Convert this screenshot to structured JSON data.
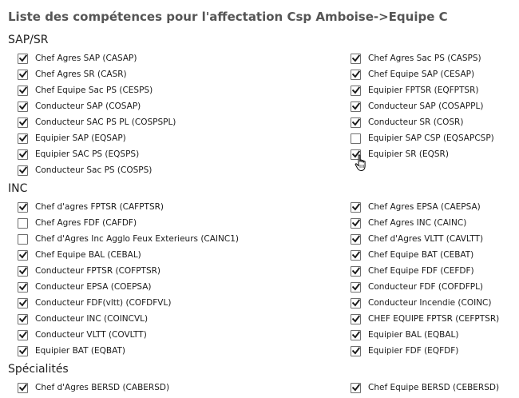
{
  "page": {
    "title": "Liste des compétences pour l'affectation Csp Amboise->Equipe C"
  },
  "sections": [
    {
      "title": "SAP/SR",
      "left": [
        {
          "label": "Chef Agres SAP (CASAP)",
          "checked": true
        },
        {
          "label": "Chef Agres SR (CASR)",
          "checked": true
        },
        {
          "label": "Chef Equipe Sac PS (CESPS)",
          "checked": true
        },
        {
          "label": "Conducteur SAP (COSAP)",
          "checked": true
        },
        {
          "label": "Conducteur SAC PS PL (COSPSPL)",
          "checked": true
        },
        {
          "label": "Equipier SAP (EQSAP)",
          "checked": true
        },
        {
          "label": "Equipier SAC PS (EQSPS)",
          "checked": true
        },
        {
          "label": "Conducteur Sac PS (COSPS)",
          "checked": true
        }
      ],
      "right": [
        {
          "label": "Chef Agres Sac PS (CASPS)",
          "checked": true
        },
        {
          "label": "Chef Equipe SAP (CESAP)",
          "checked": true
        },
        {
          "label": "Equipier FPTSR (EQFPTSR)",
          "checked": true
        },
        {
          "label": "Conducteur SAP (COSAPPL)",
          "checked": true
        },
        {
          "label": "Conducteur SR (COSR)",
          "checked": true
        },
        {
          "label": "Equipier SAP CSP (EQSAPCSP)",
          "checked": false
        },
        {
          "label": "Equipier SR (EQSR)",
          "checked": true
        }
      ]
    },
    {
      "title": "INC",
      "left": [
        {
          "label": "Chef d'agres FPTSR (CAFPTSR)",
          "checked": true
        },
        {
          "label": "Chef Agres FDF (CAFDF)",
          "checked": false
        },
        {
          "label": "Chef d'Agres Inc Agglo Feux Exterieurs (CAINC1)",
          "checked": false
        },
        {
          "label": "Chef Equipe BAL (CEBAL)",
          "checked": true
        },
        {
          "label": "Conducteur FPTSR (COFPTSR)",
          "checked": true
        },
        {
          "label": "Conducteur EPSA (COEPSA)",
          "checked": true
        },
        {
          "label": "Conducteur FDF(vltt) (COFDFVL)",
          "checked": true
        },
        {
          "label": "Conducteur INC (COINCVL)",
          "checked": true
        },
        {
          "label": "Conducteur VLTT (COVLTT)",
          "checked": true
        },
        {
          "label": "Equipier BAT (EQBAT)",
          "checked": true
        }
      ],
      "right": [
        {
          "label": "Chef Agres EPSA (CAEPSA)",
          "checked": true
        },
        {
          "label": "Chef Agres INC (CAINC)",
          "checked": true
        },
        {
          "label": "Chef d'Agres VLTT (CAVLTT)",
          "checked": true
        },
        {
          "label": "Chef Equipe BAT (CEBAT)",
          "checked": true
        },
        {
          "label": "Chef Equipe FDF (CEFDF)",
          "checked": true
        },
        {
          "label": "Conducteur FDF (COFDFPL)",
          "checked": true
        },
        {
          "label": "Conducteur Incendie (COINC)",
          "checked": true
        },
        {
          "label": "CHEF EQUIPE FPTSR (CEFPTSR)",
          "checked": true
        },
        {
          "label": "Equipier BAL (EQBAL)",
          "checked": true
        },
        {
          "label": "Equipier FDF (EQFDF)",
          "checked": true
        }
      ]
    },
    {
      "title": "Spécialités",
      "left": [
        {
          "label": "Chef d'Agres BERSD (CABERSD)",
          "checked": true
        }
      ],
      "right": [
        {
          "label": "Chef Equipe BERSD (CEBERSD)",
          "checked": true
        }
      ]
    }
  ]
}
